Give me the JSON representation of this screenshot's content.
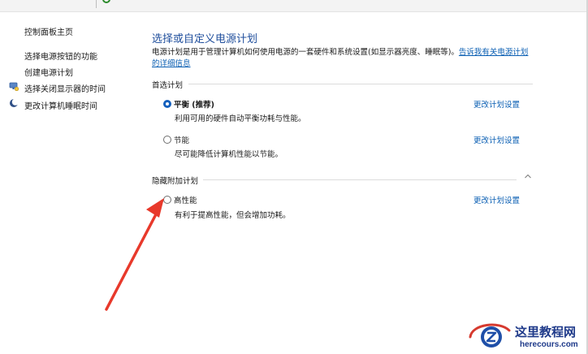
{
  "sidebar": {
    "items": [
      {
        "label": "控制面板主页"
      },
      {
        "label": "选择电源按钮的功能"
      },
      {
        "label": "创建电源计划"
      },
      {
        "label": "选择关闭显示器的时间",
        "icon": "display-power-icon"
      },
      {
        "label": "更改计算机睡眠时间",
        "icon": "moon-sleep-icon"
      }
    ]
  },
  "main": {
    "title": "选择或自定义电源计划",
    "intro_text": "电源计划是用于管理计算机如何使用电源的一套硬件和系统设置(如显示器亮度、睡眠等)。",
    "intro_link": "告诉我有关电源计划的详细信息",
    "preferred_section": "首选计划",
    "hidden_section": "隐藏附加计划",
    "plans": [
      {
        "name": "平衡 (推荐)",
        "desc": "利用可用的硬件自动平衡功耗与性能。",
        "selected": true,
        "change_link": "更改计划设置"
      },
      {
        "name": "节能",
        "desc": "尽可能降低计算机性能以节能。",
        "selected": false,
        "change_link": "更改计划设置"
      },
      {
        "name": "高性能",
        "desc": "有利于提高性能，但会增加功耗。",
        "selected": false,
        "change_link": "更改计划设置"
      }
    ]
  },
  "watermark": {
    "title": "这里教程网",
    "url": "herecours.com"
  },
  "colors": {
    "title": "#1f4e9c",
    "link": "#0b5fb3",
    "radio_selected": "#1560bd",
    "annotation_arrow": "#e8392b",
    "watermark": "#1f3a8a"
  }
}
